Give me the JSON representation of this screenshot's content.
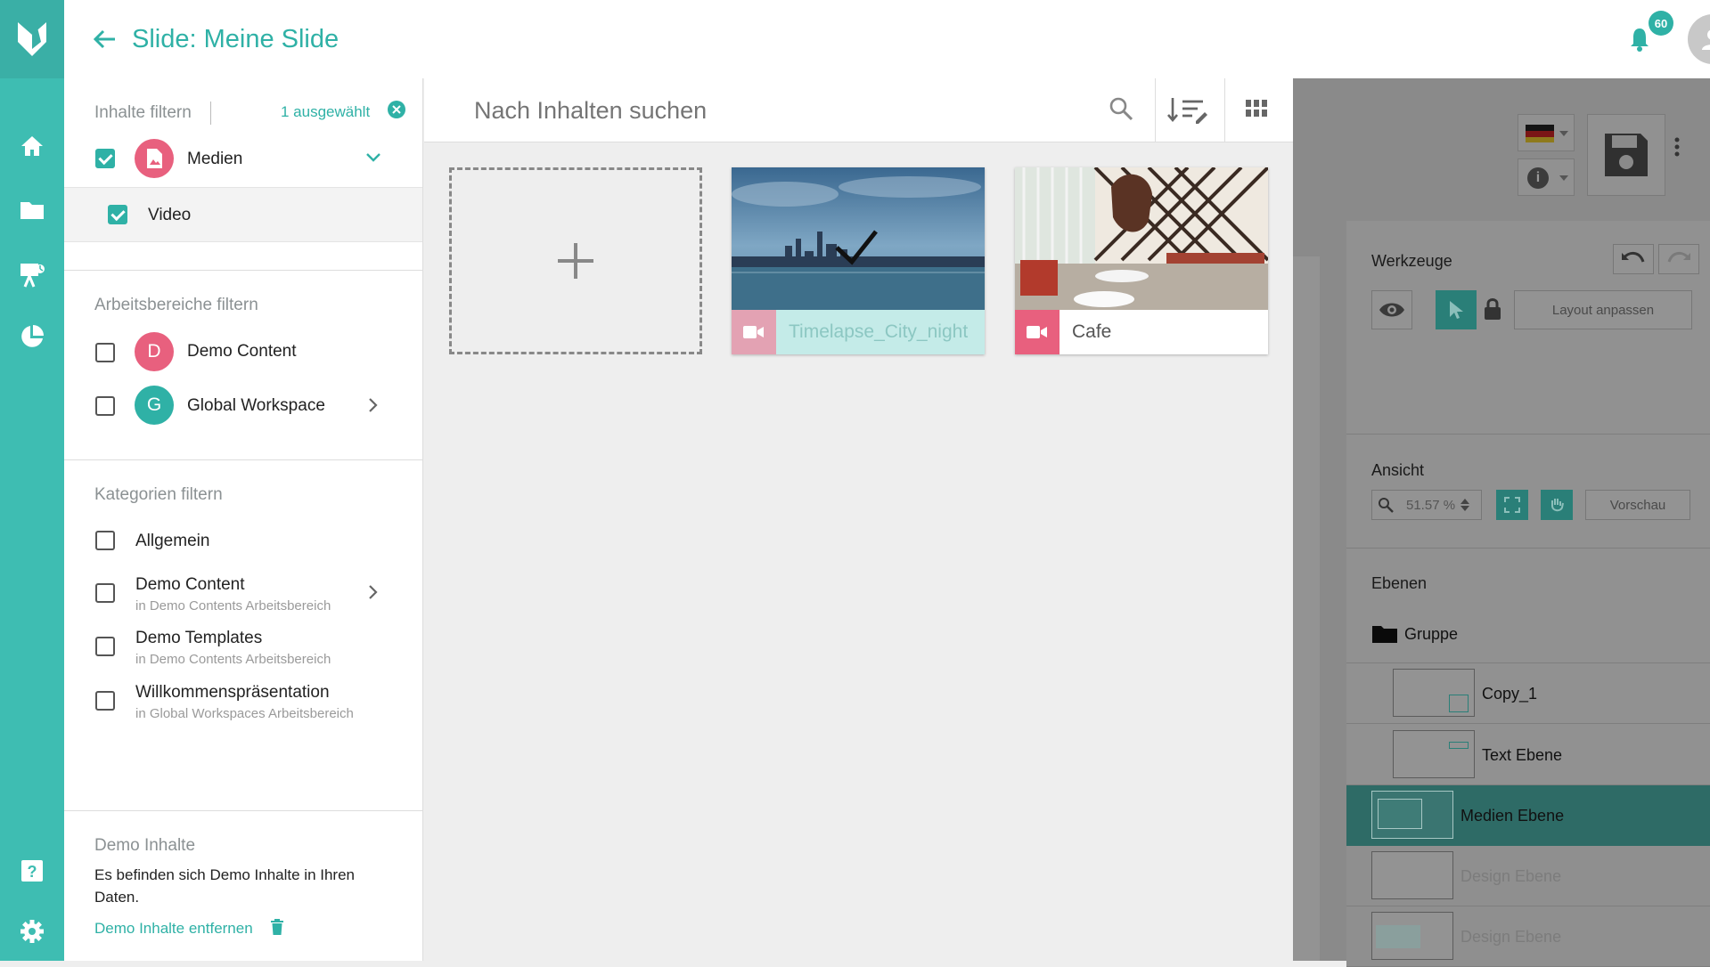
{
  "header": {
    "title": "Slide: Meine Slide",
    "notification_count": "60"
  },
  "filters": {
    "content": {
      "title": "Inhalte filtern",
      "selected_label": "1 ausgewählt",
      "items": [
        {
          "label": "Medien",
          "checked": true
        },
        {
          "label": "Video",
          "checked": true
        }
      ]
    },
    "workspaces": {
      "title": "Arbeitsbereiche filtern",
      "items": [
        {
          "initial": "D",
          "label": "Demo Content",
          "color": "#e8607e"
        },
        {
          "initial": "G",
          "label": "Global Workspace",
          "color": "#2fb1a6"
        }
      ]
    },
    "categories": {
      "title": "Kategorien filtern",
      "items": [
        {
          "label": "Allgemein",
          "sub": ""
        },
        {
          "label": "Demo Content",
          "sub": "in Demo Contents Arbeitsbereich"
        },
        {
          "label": "Demo Templates",
          "sub": "in Demo Contents Arbeitsbereich"
        },
        {
          "label": "Willkommenspräsentation",
          "sub": "in Global Workspaces Arbeitsbereich"
        }
      ]
    },
    "demo": {
      "title": "Demo Inhalte",
      "text": "Es befinden sich Demo Inhalte in Ihren Daten.",
      "link": "Demo Inhalte entfernen"
    }
  },
  "search": {
    "placeholder": "Nach Inhalten suchen"
  },
  "media": [
    {
      "name": "Timelapse_City_night",
      "selected": true
    },
    {
      "name": "Cafe",
      "selected": false
    }
  ],
  "editor": {
    "tools": {
      "title": "Werkzeuge",
      "layout_button": "Layout anpassen"
    },
    "view": {
      "title": "Ansicht",
      "zoom": "51.57 %",
      "preview_button": "Vorschau"
    },
    "layers": {
      "title": "Ebenen",
      "group": "Gruppe",
      "items": [
        {
          "name": "Copy_1"
        },
        {
          "name": "Text Ebene"
        },
        {
          "name": "Medien Ebene",
          "selected": true
        },
        {
          "name": "Design Ebene"
        },
        {
          "name": "Design Ebene"
        }
      ]
    }
  },
  "colors": {
    "brand": "#2fb1a6",
    "rail": "#3ebdb2",
    "accent_pink": "#e8607e"
  }
}
